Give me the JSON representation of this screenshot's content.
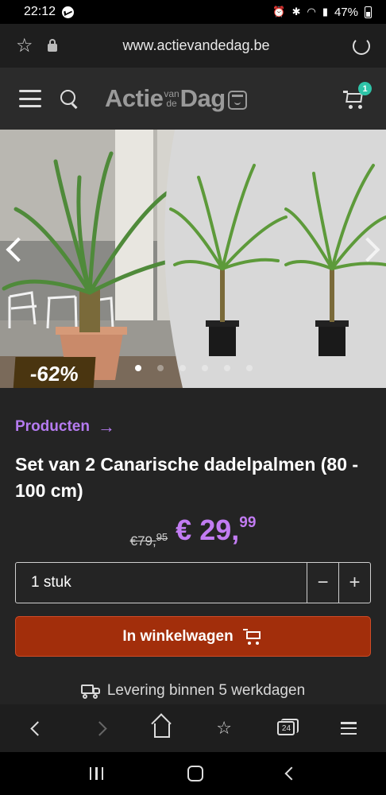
{
  "status_bar": {
    "time": "22:12",
    "battery": "47%"
  },
  "browser": {
    "url": "www.actievandedag.be",
    "tab_count": "24"
  },
  "site_header": {
    "logo_part1": "Actie",
    "logo_small_top": "van",
    "logo_small_bottom": "de",
    "logo_part2": "Dag",
    "cart_count": "1"
  },
  "carousel": {
    "discount": "-62%",
    "slide_count": 6,
    "active_slide": 0
  },
  "product": {
    "breadcrumb": "Producten",
    "title": "Set van 2 Canarische dadelpalmen (80 - 100 cm)",
    "old_price_main": "€79,",
    "old_price_cents": "95",
    "new_price_main": "€ 29,",
    "new_price_cents": "99",
    "quantity": "1 stuk",
    "minus": "−",
    "plus": "+",
    "add_to_cart": "In winkelwagen",
    "delivery": "Levering binnen 5 werkdagen"
  },
  "colors": {
    "accent_purple": "#c27cf3",
    "cart_button": "#a22e0b",
    "badge_teal": "#2ec4a8"
  }
}
